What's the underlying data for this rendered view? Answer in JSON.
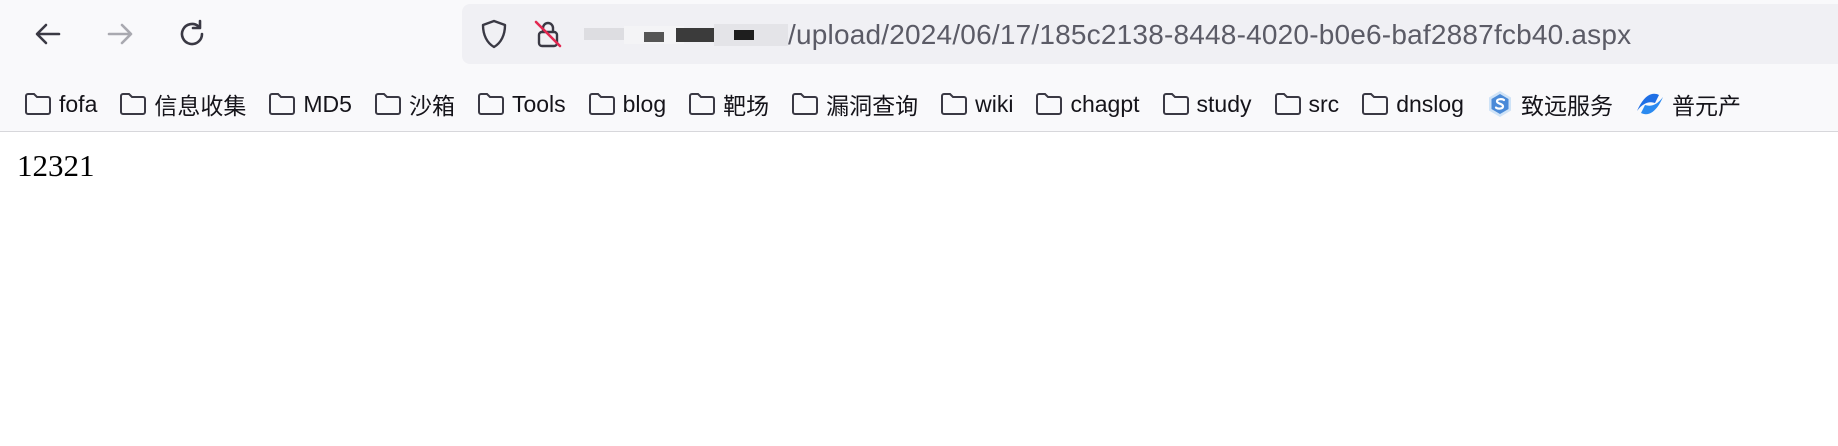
{
  "toolbar": {
    "back_icon": "arrow-left-icon",
    "forward_icon": "arrow-right-icon",
    "reload_icon": "reload-icon"
  },
  "address_bar": {
    "url": "/upload/2024/06/17/185c2138-8448-4020-b0e6-baf2887fcb40.aspx",
    "shield_icon": "shield-icon",
    "lock_icon": "insecure-lock-icon"
  },
  "bookmarks": [
    {
      "label": "fofa",
      "icon": "folder-icon"
    },
    {
      "label": "信息收集",
      "icon": "folder-icon"
    },
    {
      "label": "MD5",
      "icon": "folder-icon"
    },
    {
      "label": "沙箱",
      "icon": "folder-icon"
    },
    {
      "label": "Tools",
      "icon": "folder-icon"
    },
    {
      "label": "blog",
      "icon": "folder-icon"
    },
    {
      "label": "靶场",
      "icon": "folder-icon"
    },
    {
      "label": "漏洞查询",
      "icon": "folder-icon"
    },
    {
      "label": "wiki",
      "icon": "folder-icon"
    },
    {
      "label": "chagpt",
      "icon": "folder-icon"
    },
    {
      "label": "study",
      "icon": "folder-icon"
    },
    {
      "label": "src",
      "icon": "folder-icon"
    },
    {
      "label": "dnslog",
      "icon": "folder-icon"
    },
    {
      "label": "致远服务",
      "icon": "seeyon-logo-icon"
    },
    {
      "label": "普元产",
      "icon": "primeton-logo-icon"
    }
  ],
  "page": {
    "body_text": "12321"
  },
  "colors": {
    "chrome_bg": "#f9f9fb",
    "url_bar_bg": "#f0f0f4",
    "url_text": "#5b5b66",
    "icon": "#5b5b66",
    "lock_strike": "#e22850"
  }
}
